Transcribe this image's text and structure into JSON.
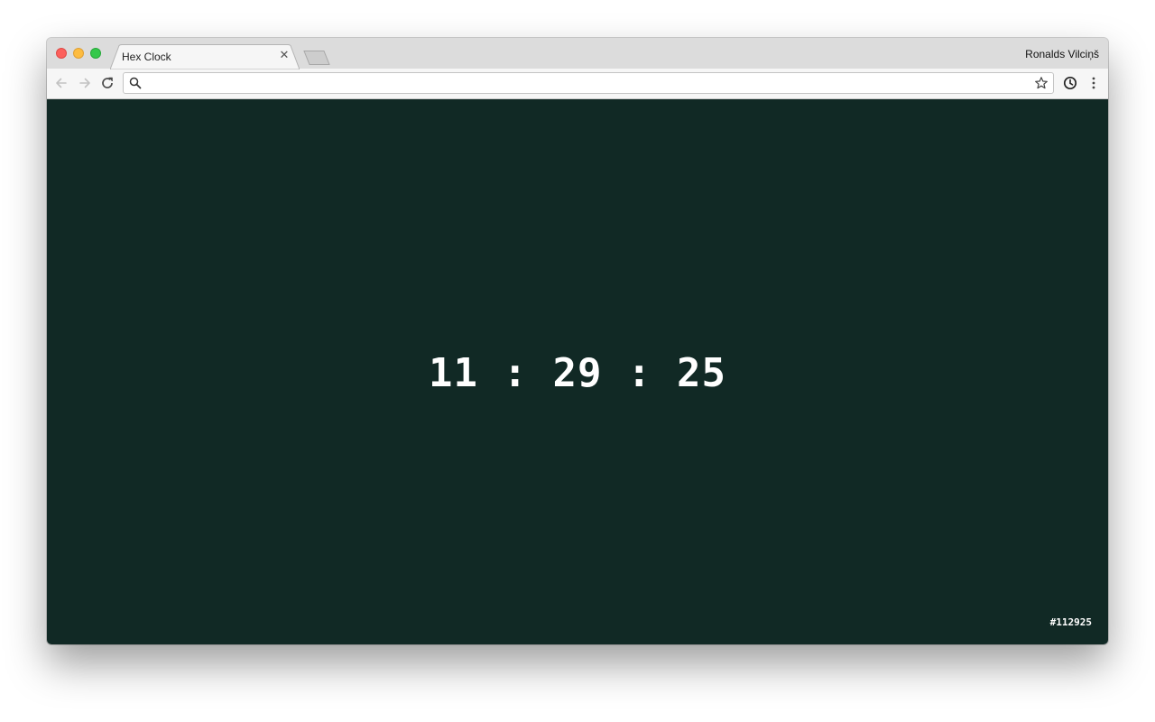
{
  "browser": {
    "tab": {
      "title": "Hex Clock"
    },
    "profile_name": "Ronalds Vilciņš",
    "omnibox": {
      "value": "",
      "placeholder": ""
    }
  },
  "page": {
    "background_color": "#112925",
    "clock": {
      "hours": "11",
      "minutes": "29",
      "seconds": "25",
      "separator": ":",
      "display": "11 : 29 : 25"
    },
    "hex_label": "#112925"
  },
  "icons": {
    "back": "arrow-left-icon",
    "forward": "arrow-right-icon",
    "reload": "reload-icon",
    "search": "search-icon",
    "bookmark": "star-icon",
    "extension": "clock-icon",
    "menu": "kebab-menu-icon",
    "tab_close": "close-icon"
  }
}
